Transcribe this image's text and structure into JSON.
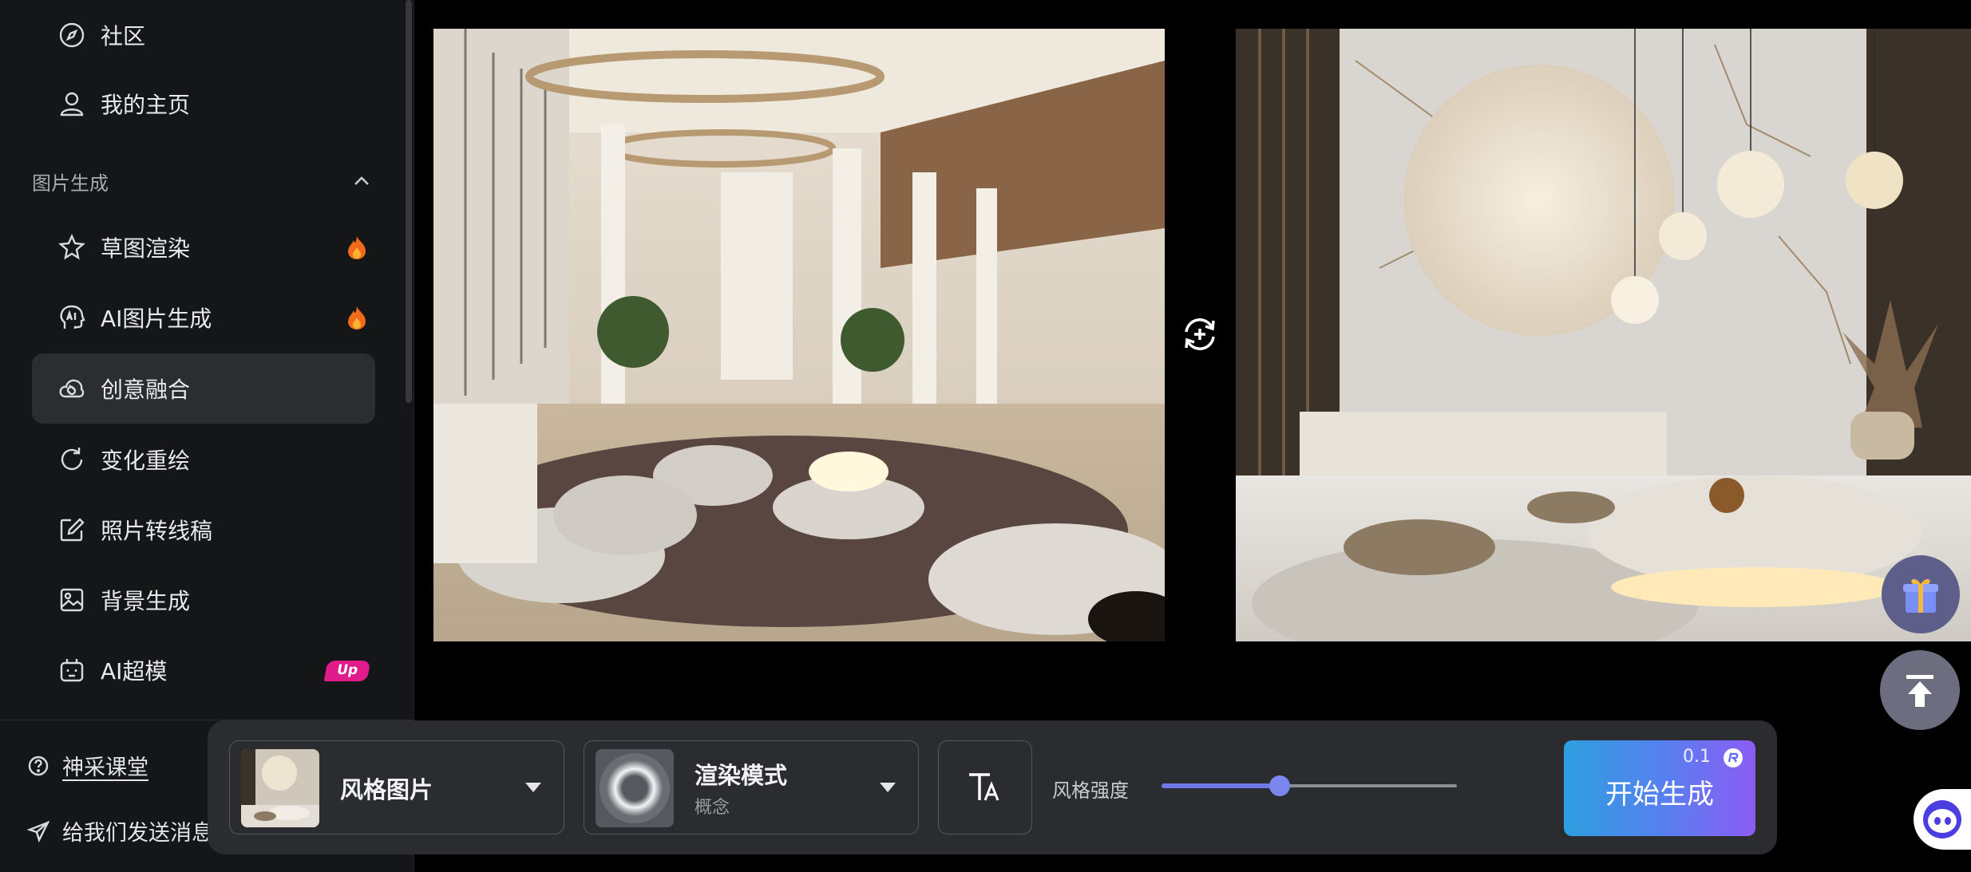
{
  "sidebar": {
    "top_items": [
      {
        "label": "社区",
        "icon": "compass-icon"
      },
      {
        "label": "我的主页",
        "icon": "user-icon"
      }
    ],
    "section_title": "图片生成",
    "items": [
      {
        "label": "草图渲染",
        "icon": "sketch-star-icon",
        "badge": "fire"
      },
      {
        "label": "AI图片生成",
        "icon": "ai-brain-icon",
        "badge": "fire"
      },
      {
        "label": "创意融合",
        "icon": "cloud-merge-icon",
        "active": true
      },
      {
        "label": "变化重绘",
        "icon": "refresh-icon"
      },
      {
        "label": "照片转线稿",
        "icon": "edit-square-icon"
      },
      {
        "label": "背景生成",
        "icon": "image-icon"
      },
      {
        "label": "AI超模",
        "icon": "robot-icon",
        "badge": "Up"
      }
    ],
    "footer": {
      "course_label": "神采课堂",
      "feedback_label": "给我们发送消息"
    }
  },
  "canvas": {
    "left_image": "hotel-lobby-render",
    "right_image": "marble-lobby-render",
    "swap_icon": "swap-add-icon"
  },
  "toolbar": {
    "style_image_label": "风格图片",
    "render_mode_label": "渲染模式",
    "render_mode_value": "概念",
    "strength_label": "风格强度",
    "strength_value": 0.4,
    "generate_label": "开始生成",
    "cost": "0.1"
  },
  "colors": {
    "accent": "#6c79e6",
    "fire": "#f26a1b",
    "up_badge": "#e21b8a"
  }
}
